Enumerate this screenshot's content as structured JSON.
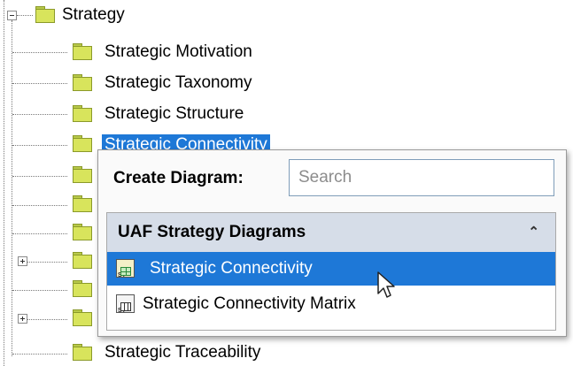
{
  "tree": {
    "root": {
      "label": "Strategy",
      "expanded": true
    },
    "children": [
      {
        "label": "Strategic Motivation",
        "expandable": false
      },
      {
        "label": "Strategic Taxonomy",
        "expandable": false
      },
      {
        "label": "Strategic Structure",
        "expandable": false
      },
      {
        "label": "Strategic Connectivity",
        "expandable": false,
        "selected": true
      },
      {
        "label": "",
        "expandable": false
      },
      {
        "label": "",
        "expandable": false
      },
      {
        "label": "",
        "expandable": false
      },
      {
        "label": "",
        "expandable": true
      },
      {
        "label": "",
        "expandable": false
      },
      {
        "label": "",
        "expandable": true
      },
      {
        "label": "Strategic Traceability",
        "expandable": false
      }
    ]
  },
  "popup": {
    "create_label": "Create Diagram:",
    "search_placeholder": "Search",
    "group": {
      "title": "UAF Strategy Diagrams",
      "collapse_glyph": "⌃"
    },
    "items": [
      {
        "label": "Strategic Connectivity",
        "icon": "strategic-connectivity-diagram-icon",
        "selected": true
      },
      {
        "label": "Strategic Connectivity Matrix",
        "icon": "strategic-connectivity-matrix-icon",
        "selected": false
      }
    ]
  },
  "colors": {
    "selection": "#1e78d7",
    "group_header": "#d6dde8",
    "folder": "#d8e45c"
  }
}
